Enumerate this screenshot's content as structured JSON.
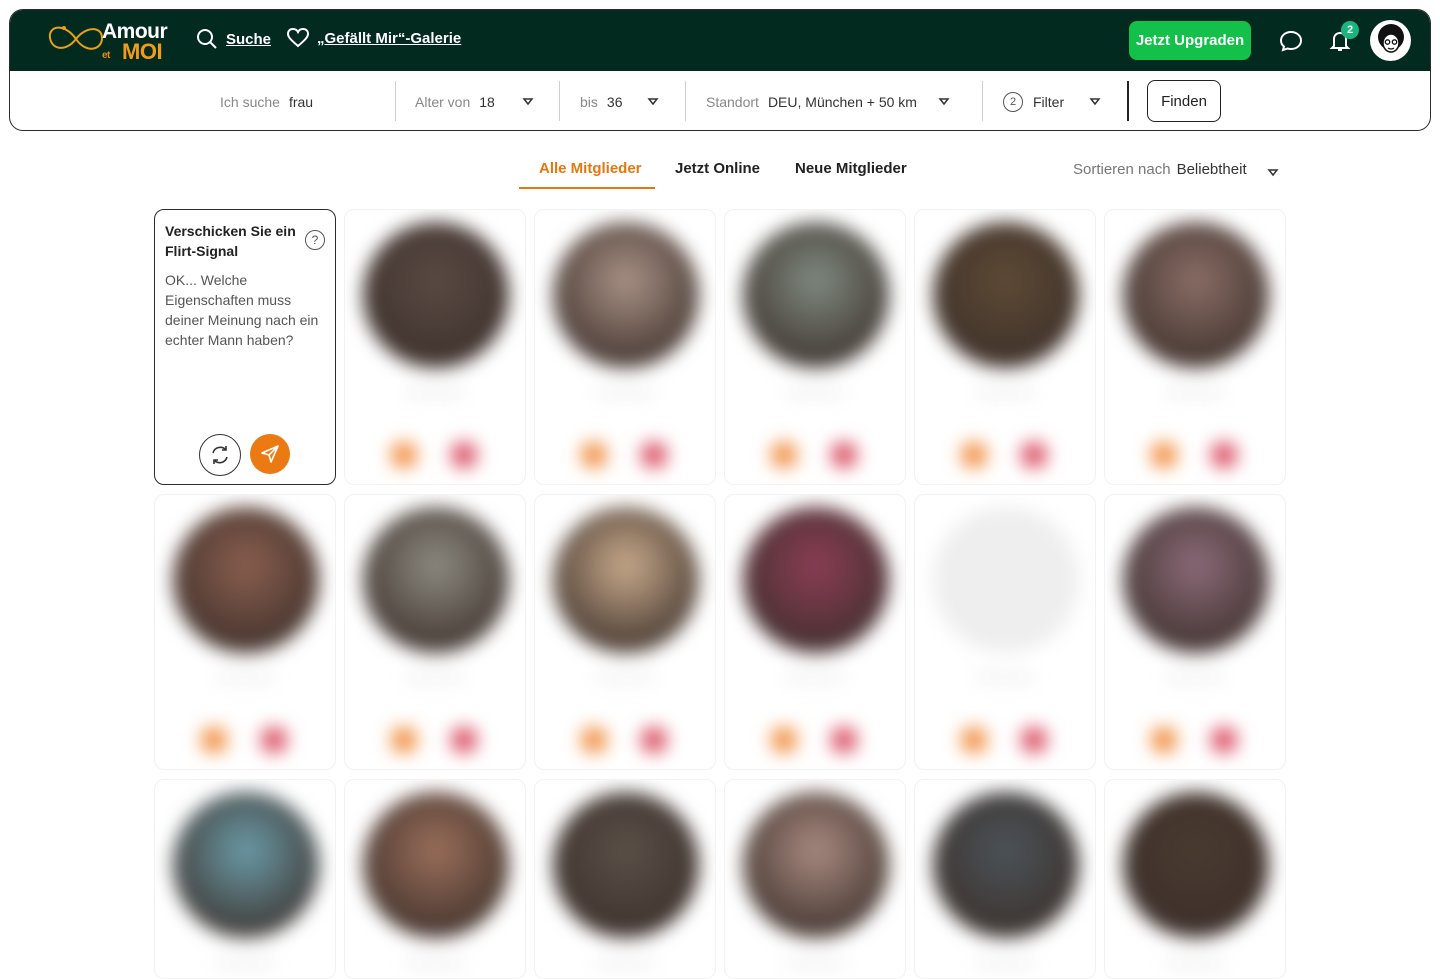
{
  "header": {
    "logo": {
      "word1": "Amour",
      "word2": "et",
      "word3": "MOI"
    },
    "nav": [
      {
        "label": "Suche",
        "icon": "search-icon"
      },
      {
        "label": "„Gefällt Mir“-Galerie",
        "icon": "heart-icon"
      }
    ],
    "upgrade_label": "Jetzt Upgraden",
    "notifications_count": "2"
  },
  "search": {
    "seeking_label": "Ich suche",
    "seeking_value": "frau",
    "age_from_label": "Alter von",
    "age_from_value": "18",
    "age_to_label": "bis",
    "age_to_value": "36",
    "location_label": "Standort",
    "location_value": "DEU, München + 50 km",
    "filter_count": "2",
    "filter_label": "Filter",
    "submit_label": "Finden"
  },
  "tabs": [
    {
      "label": "Alle Mitglieder",
      "active": true
    },
    {
      "label": "Jetzt Online",
      "active": false
    },
    {
      "label": "Neue Mitglieder",
      "active": false
    }
  ],
  "sort": {
    "label": "Sortieren nach",
    "value": "Beliebtheit"
  },
  "flirt": {
    "title": "Verschicken Sie ein Flirt-Signal",
    "help": "?",
    "text": "OK... Welche Eigenschaften muss deiner Meinung nach ein echter Mann haben?"
  },
  "colors": {
    "header_bg": "#032a1e",
    "accent": "#e8760e",
    "upgrade": "#13c04a",
    "badge": "#1ab47f"
  },
  "members": [
    {
      "color": "#5a4a44"
    },
    {
      "color": "#a99185"
    },
    {
      "color": "#7f8a80"
    },
    {
      "color": "#5e4a35"
    },
    {
      "color": "#8a6e66"
    },
    {
      "color": "#8a5e4f"
    },
    {
      "color": "#8d8a80"
    },
    {
      "color": "#c7a98a"
    },
    {
      "color": "#8b3d55"
    },
    {
      "color": "#e8e8e8"
    },
    {
      "color": "#8a6a78"
    },
    {
      "color": "#6a9aa6"
    },
    {
      "color": "#9a6e5a"
    },
    {
      "color": "#5a5048"
    },
    {
      "color": "#a88a80"
    },
    {
      "color": "#4b5358"
    },
    {
      "color": "#4a3a30"
    }
  ]
}
